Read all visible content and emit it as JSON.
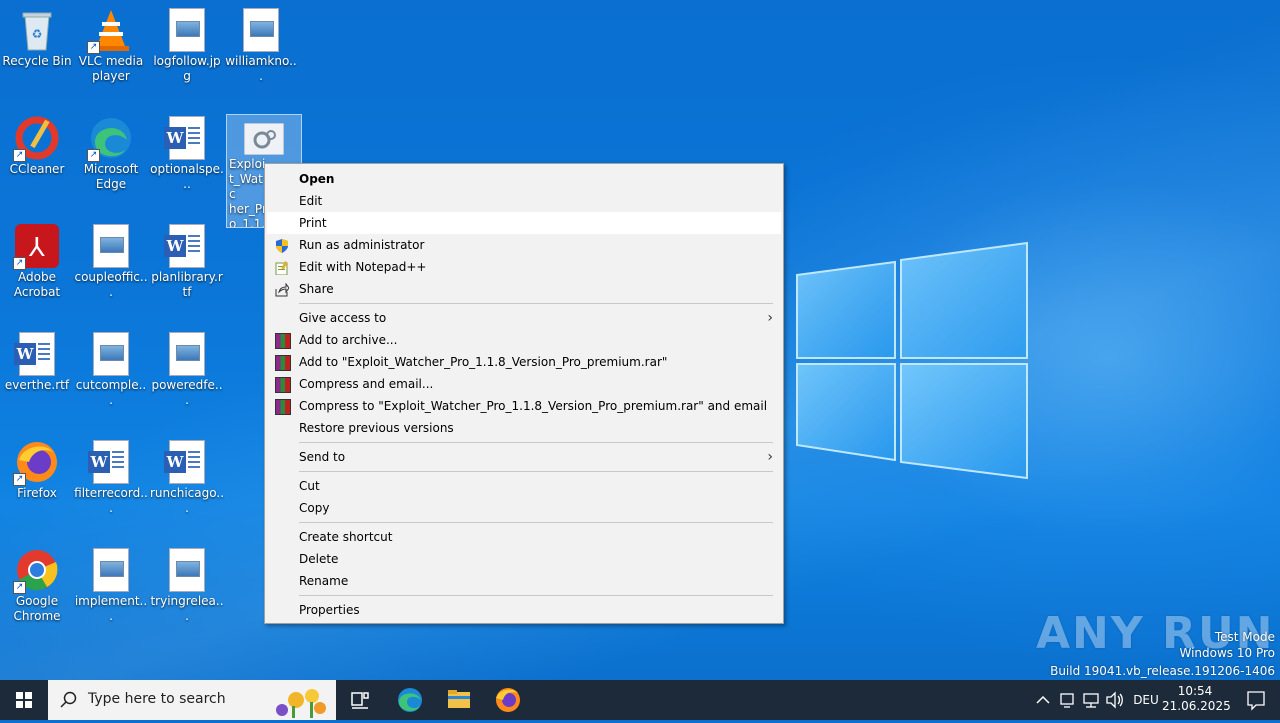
{
  "desktop": {
    "icons": [
      {
        "label": "Recycle Bin"
      },
      {
        "label": "VLC media player"
      },
      {
        "label": "logfollow.jpg"
      },
      {
        "label": "williamkno..."
      },
      {
        "label": "CCleaner"
      },
      {
        "label": "Microsoft Edge"
      },
      {
        "label": "optionalspe..."
      },
      {
        "label": "Exploit_Watc her_Pro_1.1.8 _Versio premiu"
      },
      {
        "label": "Adobe Acrobat"
      },
      {
        "label": "coupleoffic..."
      },
      {
        "label": "planlibrary.rtf"
      },
      {
        "label": "everthe.rtf"
      },
      {
        "label": "cutcomple..."
      },
      {
        "label": "poweredfe..."
      },
      {
        "label": "Firefox"
      },
      {
        "label": "filterrecord..."
      },
      {
        "label": "runchicago..."
      },
      {
        "label": "Google Chrome"
      },
      {
        "label": "implement..."
      },
      {
        "label": "tryingrelea..."
      }
    ]
  },
  "context_menu": {
    "items": [
      {
        "label": "Open"
      },
      {
        "label": "Edit"
      },
      {
        "label": "Print"
      },
      {
        "label": "Run as administrator"
      },
      {
        "label": "Edit with Notepad++"
      },
      {
        "label": "Share"
      },
      {
        "label": "Give access to"
      },
      {
        "label": "Add to archive..."
      },
      {
        "label": "Add to \"Exploit_Watcher_Pro_1.1.8_Version_Pro_premium.rar\""
      },
      {
        "label": "Compress and email..."
      },
      {
        "label": "Compress to \"Exploit_Watcher_Pro_1.1.8_Version_Pro_premium.rar\" and email"
      },
      {
        "label": "Restore previous versions"
      },
      {
        "label": "Send to"
      },
      {
        "label": "Cut"
      },
      {
        "label": "Copy"
      },
      {
        "label": "Create shortcut"
      },
      {
        "label": "Delete"
      },
      {
        "label": "Rename"
      },
      {
        "label": "Properties"
      }
    ]
  },
  "taskbar": {
    "search_placeholder": "Type here to search",
    "language": "DEU",
    "time": "10:54",
    "date": "21.06.2025"
  },
  "watermark": {
    "brand": "ANY RUN",
    "line1": "Test Mode",
    "line2": "Windows 10 Pro",
    "line3": "Build 19041.vb_release.191206-1406"
  },
  "colors": {
    "desktop": "#0b76d8",
    "taskbar": "#1c2a3a",
    "menu_bg": "#f2f2f2",
    "menu_hover": "#ffffff"
  }
}
